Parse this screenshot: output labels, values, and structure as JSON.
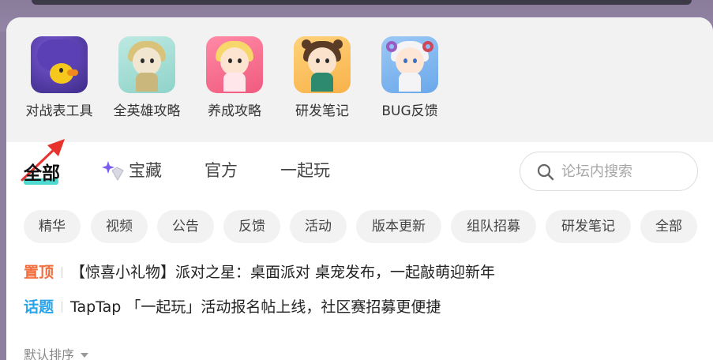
{
  "shortcuts": [
    {
      "label": "对战表工具",
      "icon": "duck-avatar-icon"
    },
    {
      "label": "全英雄攻略",
      "icon": "robot-knight-icon"
    },
    {
      "label": "养成攻略",
      "icon": "blonde-girl-icon"
    },
    {
      "label": "研发笔记",
      "icon": "bear-hood-kid-icon"
    },
    {
      "label": "BUG反馈",
      "icon": "horned-sheep-kid-icon"
    }
  ],
  "tabs": {
    "all": "全部",
    "treasure": "宝藏",
    "official": "官方",
    "play_together": "一起玩"
  },
  "search": {
    "placeholder": "论坛内搜索"
  },
  "chips": [
    "精华",
    "视频",
    "公告",
    "反馈",
    "活动",
    "版本更新",
    "组队招募",
    "研发笔记",
    "全部"
  ],
  "notices": [
    {
      "tag": "置顶",
      "tag_color": "#f26d3c",
      "text": "【惊喜小礼物】派对之星：桌面派对 桌宠发布，一起敲萌迎新年"
    },
    {
      "tag": "话题",
      "tag_color": "#2aa4e8",
      "text": "TapTap 「一起玩」活动报名帖上线，社区赛招募更便捷"
    }
  ],
  "sort": {
    "label": "默认排序"
  },
  "colors": {
    "accent": "#2fd3c8",
    "annotation_arrow": "#e8322e"
  }
}
